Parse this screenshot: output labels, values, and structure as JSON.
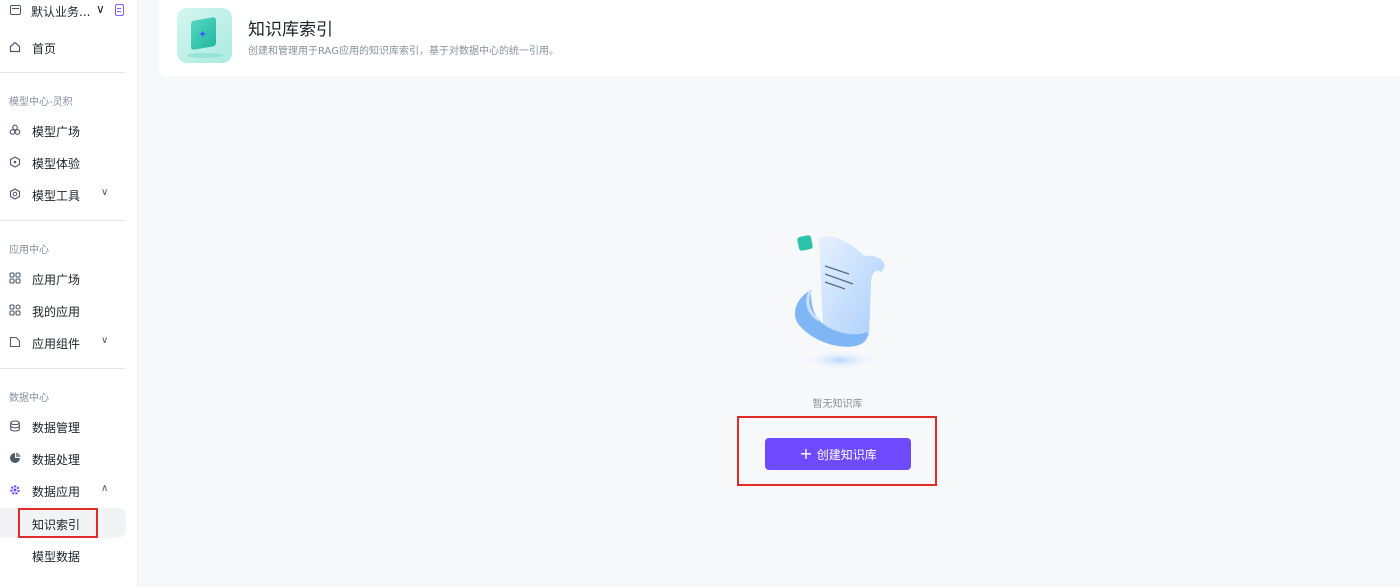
{
  "workspace": {
    "name": "默认业务..."
  },
  "sidebar": {
    "home": "首页",
    "sections": [
      {
        "title": "模型中心-灵积",
        "items": [
          {
            "label": "模型广场"
          },
          {
            "label": "模型体验"
          },
          {
            "label": "模型工具"
          }
        ]
      },
      {
        "title": "应用中心",
        "items": [
          {
            "label": "应用广场"
          },
          {
            "label": "我的应用"
          },
          {
            "label": "应用组件"
          }
        ]
      },
      {
        "title": "数据中心",
        "items": [
          {
            "label": "数据管理"
          },
          {
            "label": "数据处理"
          },
          {
            "label": "数据应用"
          }
        ]
      }
    ],
    "sub_items": [
      {
        "label": "知识索引",
        "active": true
      },
      {
        "label": "模型数据"
      }
    ]
  },
  "header": {
    "title": "知识库索引",
    "subtitle": "创建和管理用于RAG应用的知识库索引，基于对数据中心的统一引用。"
  },
  "empty": {
    "text": "暂无知识库"
  },
  "create_button": {
    "label": "创建知识库"
  },
  "colors": {
    "accent": "#6d4aff",
    "highlight": "#e02b2b"
  }
}
